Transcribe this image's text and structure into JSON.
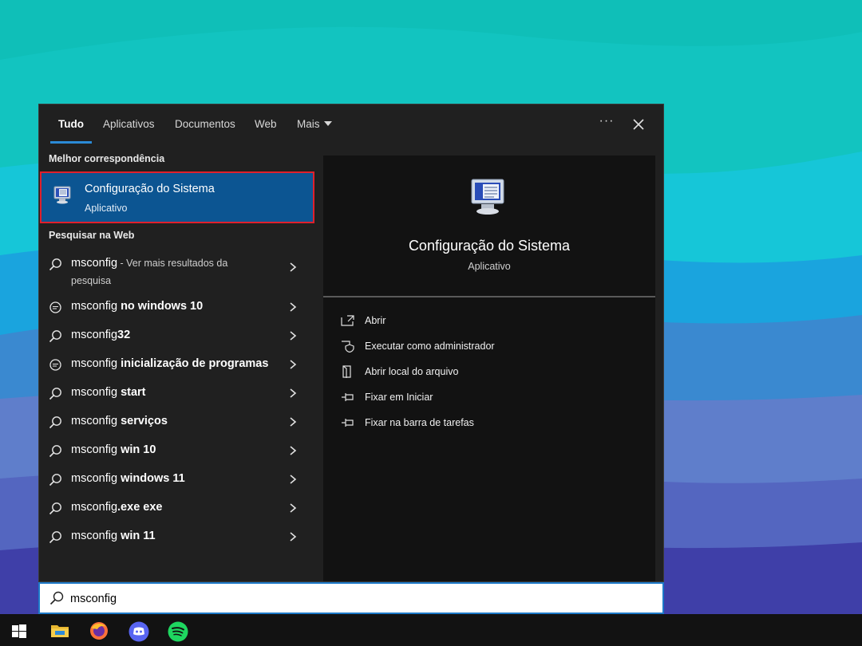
{
  "tabs": [
    {
      "label": "Tudo",
      "active": true
    },
    {
      "label": "Aplicativos",
      "active": false
    },
    {
      "label": "Documentos",
      "active": false
    },
    {
      "label": "Web",
      "active": false
    },
    {
      "label": "Mais",
      "active": false
    }
  ],
  "header": {
    "more_icon": "ellipsis-icon",
    "more_label": "···",
    "close_icon": "close-icon"
  },
  "best_match": {
    "section_label": "Melhor correspondência",
    "title": "Configuração do Sistema",
    "subtitle": "Aplicativo",
    "icon": "system-configuration-icon"
  },
  "web_search": {
    "section_label": "Pesquisar na Web",
    "results": [
      {
        "prefix": "msconfig",
        "bold": "",
        "suffix": " - Ver mais resultados da",
        "suffix2": "pesquisa",
        "icon": "search-icon"
      },
      {
        "prefix": "msconfig ",
        "bold": "no windows 10",
        "icon": "chat-search-icon"
      },
      {
        "prefix": "msconfig",
        "bold": "32",
        "icon": "search-icon"
      },
      {
        "prefix": "msconfig ",
        "bold": "inicialização de programas",
        "icon": "chat-search-icon"
      },
      {
        "prefix": "msconfig ",
        "bold": "start",
        "icon": "search-icon"
      },
      {
        "prefix": "msconfig ",
        "bold": "serviços",
        "icon": "search-icon"
      },
      {
        "prefix": "msconfig ",
        "bold": "win 10",
        "icon": "search-icon"
      },
      {
        "prefix": "msconfig ",
        "bold": "windows 11",
        "icon": "search-icon"
      },
      {
        "prefix": "msconfig",
        "bold": ".exe exe",
        "icon": "search-icon"
      },
      {
        "prefix": "msconfig ",
        "bold": "win 11",
        "icon": "search-icon"
      }
    ]
  },
  "preview": {
    "title": "Configuração do Sistema",
    "subtitle": "Aplicativo",
    "actions": [
      {
        "label": "Abrir",
        "icon": "open-icon"
      },
      {
        "label": "Executar como administrador",
        "icon": "shield-icon"
      },
      {
        "label": "Abrir local do arquivo",
        "icon": "file-location-icon"
      },
      {
        "label": "Fixar em Iniciar",
        "icon": "pin-icon"
      },
      {
        "label": "Fixar na barra de tarefas",
        "icon": "pin-icon"
      }
    ]
  },
  "search": {
    "value": "msconfig",
    "icon": "search-icon"
  },
  "taskbar": {
    "items": [
      {
        "name": "start-button",
        "icon": "windows-logo-icon"
      },
      {
        "name": "file-explorer",
        "icon": "folder-icon"
      },
      {
        "name": "firefox",
        "icon": "firefox-icon"
      },
      {
        "name": "discord",
        "icon": "discord-icon"
      },
      {
        "name": "spotify",
        "icon": "spotify-icon"
      }
    ]
  },
  "colors": {
    "accent": "#2b8ad6",
    "selected": "#0c5592",
    "highlight_border": "#e0202c",
    "panel": "#202020"
  }
}
